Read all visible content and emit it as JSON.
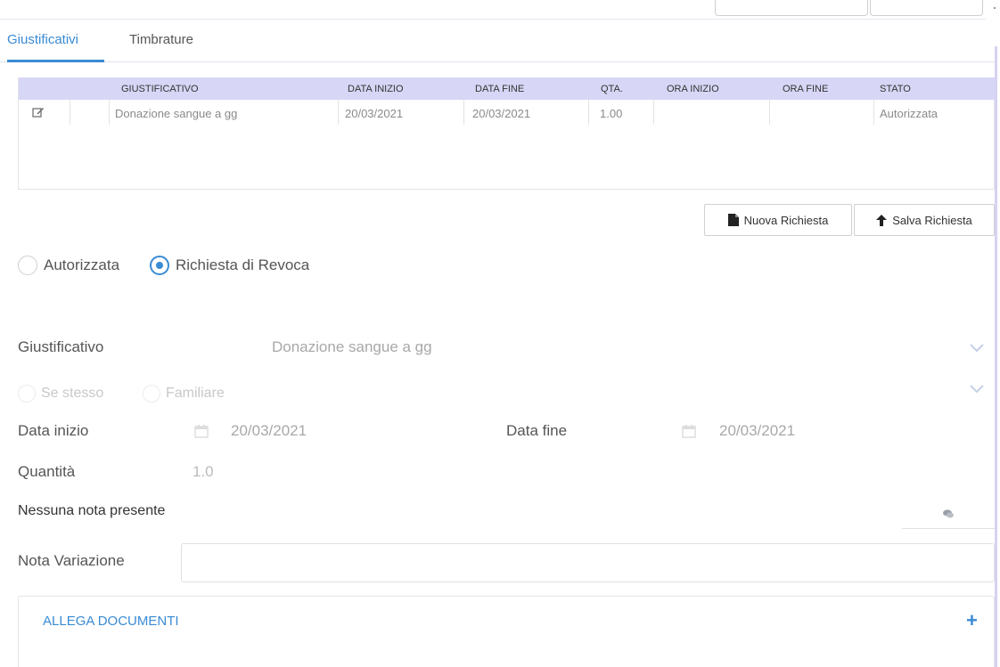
{
  "tabs": [
    {
      "label": "Giustificativi",
      "active": true
    },
    {
      "label": "Timbrature",
      "active": false
    }
  ],
  "grid": {
    "columns": [
      "GIUSTIFICATIVO",
      "DATA INIZIO",
      "DATA FINE",
      "QTA.",
      "ORA INIZIO",
      "ORA FINE",
      "STATO"
    ],
    "rows": [
      {
        "giustificativo": "Donazione sangue a gg",
        "data_inizio": "20/03/2021",
        "data_fine": "20/03/2021",
        "qta": "1.00",
        "ora_inizio": "",
        "ora_fine": "",
        "stato": "Autorizzata"
      }
    ]
  },
  "buttons": {
    "nuova": "Nuova Richiesta",
    "salva": "Salva Richiesta"
  },
  "radios": [
    {
      "label": "Autorizzata",
      "selected": false
    },
    {
      "label": "Richiesta di Revoca",
      "selected": true
    }
  ],
  "form": {
    "giustificativo_label": "Giustificativo",
    "giustificativo_value": "Donazione sangue a gg",
    "se_stesso": "Se stesso",
    "familiare": "Familiare",
    "data_inizio_label": "Data inizio",
    "data_inizio_value": "20/03/2021",
    "data_fine_label": "Data fine",
    "data_fine_value": "20/03/2021",
    "quantita_label": "Quantità",
    "quantita_value": "1.0",
    "nota_presente": "Nessuna nota presente",
    "nota_variazione_label": "Nota Variazione",
    "nota_variazione_value": ""
  },
  "allega": {
    "title": "ALLEGA DOCUMENTI",
    "plus": "+"
  },
  "colors": {
    "accent": "#3a8bd4",
    "grid_header": "#d8d6f6",
    "border": "#e0e0e0"
  }
}
